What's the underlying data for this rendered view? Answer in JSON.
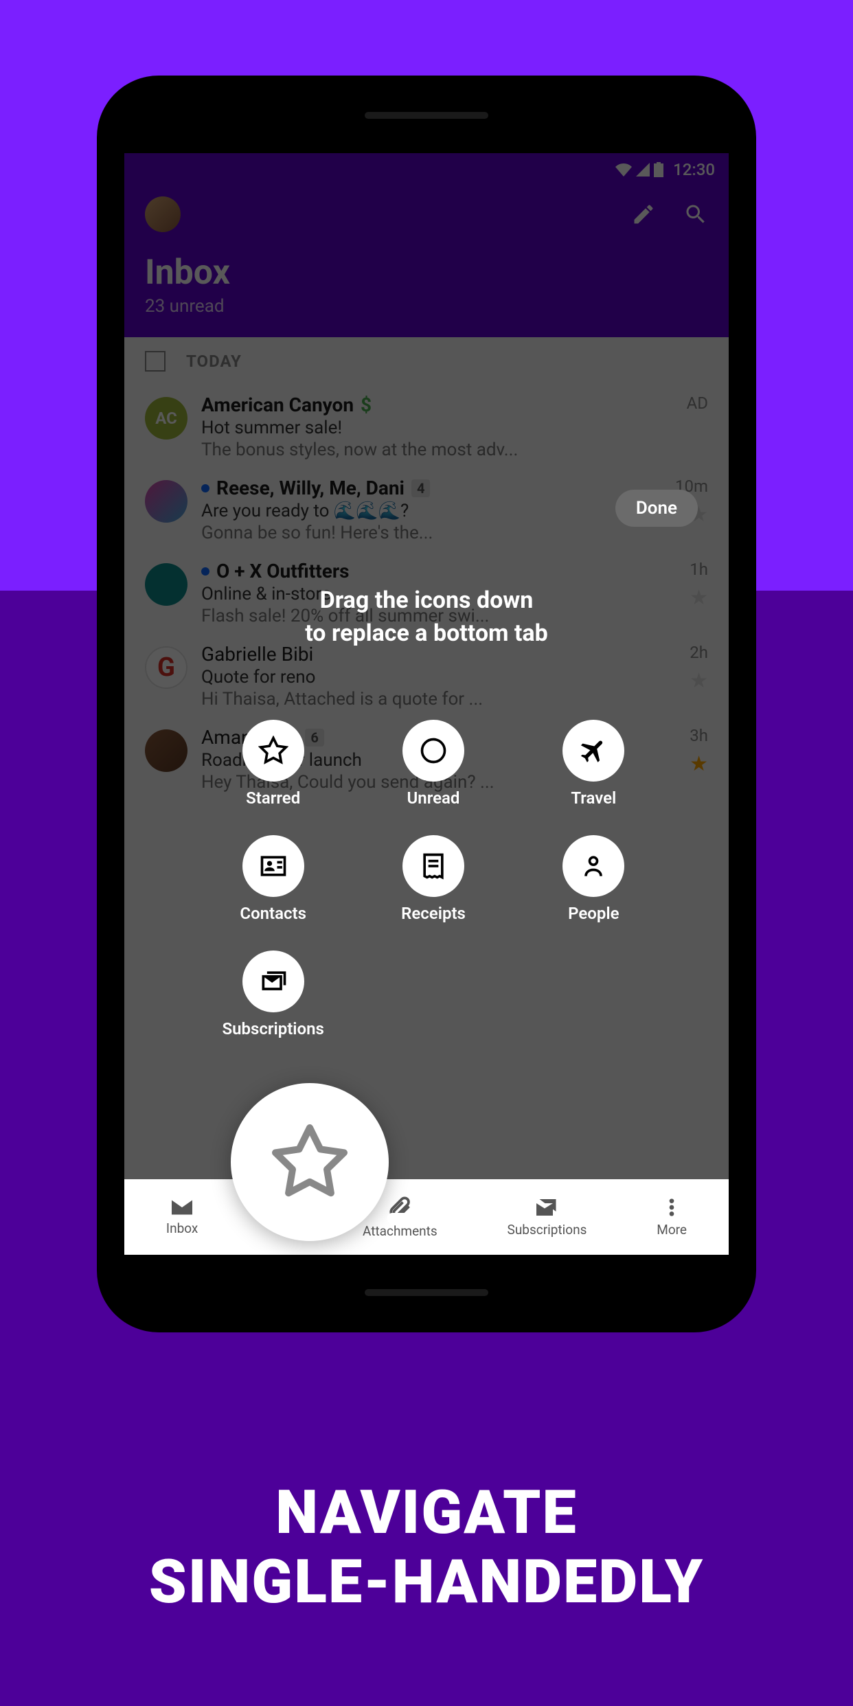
{
  "status": {
    "time": "12:30"
  },
  "header": {
    "title": "Inbox",
    "subtitle": "23 unread"
  },
  "section": {
    "label": "TODAY"
  },
  "tutorial": {
    "done": "Done",
    "text_line1": "Drag the icons down",
    "text_line2": "to replace a bottom tab"
  },
  "draggables": {
    "starred": "Starred",
    "unread": "Unread",
    "travel": "Travel",
    "contacts": "Contacts",
    "receipts": "Receipts",
    "people": "People",
    "subscriptions": "Subscriptions"
  },
  "emails": [
    {
      "avatar": "AC",
      "sender": "American Canyon",
      "subject": "Hot summer sale!",
      "preview": "The bonus styles, now at the most adv...",
      "time": "AD",
      "sponsored": true
    },
    {
      "sender": "Reese, Willy, Me, Dani",
      "count": "4",
      "subject": "Are you ready to 🌊🌊🌊?",
      "preview": "Gonna be so fun! Here's the...",
      "time": "10m",
      "unread": true
    },
    {
      "sender": "O + X Outfitters",
      "subject": "Online & in-store",
      "preview": "Flash sale! 20% off all summer swi...",
      "time": "1h",
      "unread": true
    },
    {
      "sender": "Gabrielle Bibi",
      "subject": "Quote for reno",
      "preview": "Hi Thaisa, Attached is a quote for ...",
      "time": "2h"
    },
    {
      "sender": "Amanda Le",
      "count": "6",
      "subject": "Roadmap for launch",
      "preview": "Hey Thaisa, Could you send again? ...",
      "time": "3h",
      "starred": true
    }
  ],
  "nav": {
    "inbox": "Inbox",
    "attachments": "Attachments",
    "subscriptions": "Subscriptions",
    "more": "More"
  },
  "caption": {
    "line1": "NAVIGATE",
    "line2": "SINGLE-HANDEDLY"
  }
}
